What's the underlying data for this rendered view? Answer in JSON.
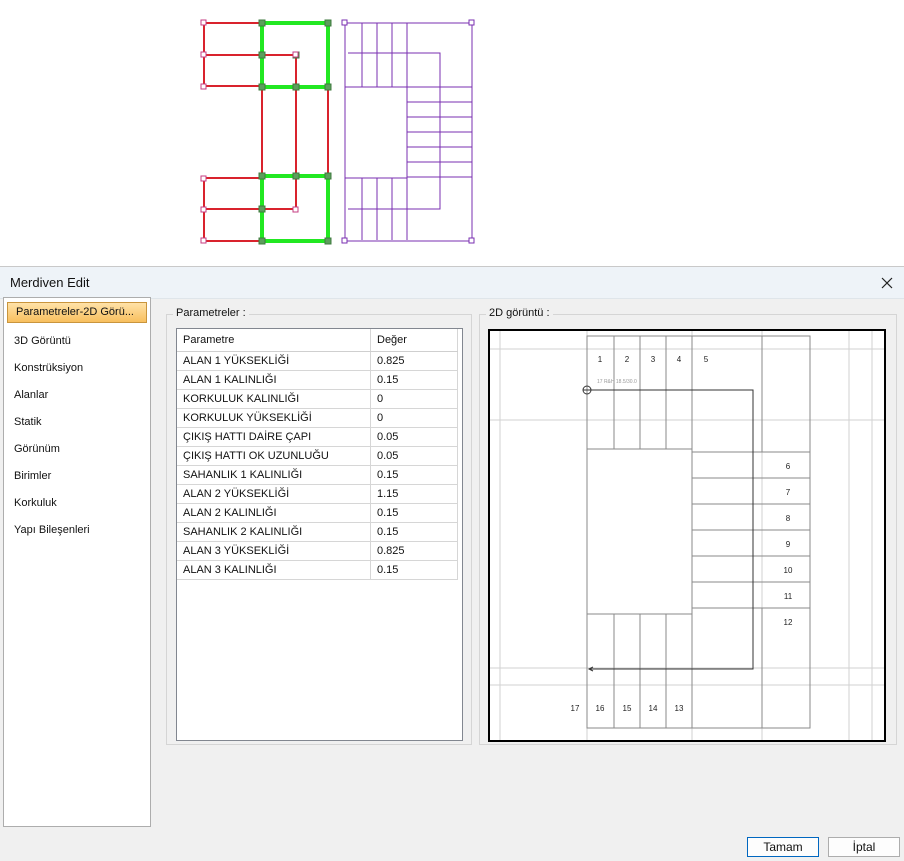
{
  "dialog": {
    "title": "Merdiven Edit",
    "close_icon": "close-icon"
  },
  "nav": {
    "items": [
      "Parametreler-2D Görü...",
      "3D Görüntü",
      "Konstrüksiyon",
      "Alanlar",
      "Statik",
      "Görünüm",
      "Birimler",
      "Korkuluk",
      "Yapı Bileşenleri"
    ],
    "active_index": 0
  },
  "parameters": {
    "legend": "Parametreler :",
    "columns": [
      "Parametre",
      "Değer"
    ],
    "rows": [
      [
        "ALAN 1 YÜKSEKLİĞİ",
        "0.825"
      ],
      [
        "ALAN 1 KALINLIĞI",
        "0.15"
      ],
      [
        "KORKULUK KALINLIĞI",
        "0"
      ],
      [
        "KORKULUK YÜKSEKLİĞİ",
        "0"
      ],
      [
        "ÇIKIŞ HATTI DAİRE ÇAPI",
        "0.05"
      ],
      [
        "ÇIKIŞ HATTI OK UZUNLUĞU",
        "0.05"
      ],
      [
        "SAHANLIK 1 KALINLIĞI",
        "0.15"
      ],
      [
        "ALAN 2 YÜKSEKLİĞİ",
        "1.15"
      ],
      [
        "ALAN 2 KALINLIĞI",
        "0.15"
      ],
      [
        "SAHANLIK 2 KALINLIĞI",
        "0.15"
      ],
      [
        "ALAN 3 YÜKSEKLİĞİ",
        "0.825"
      ],
      [
        "ALAN 3 KALINLIĞI",
        "0.15"
      ]
    ]
  },
  "preview": {
    "legend": "2D görüntü :",
    "top_steps": [
      "1",
      "2",
      "3",
      "4",
      "5"
    ],
    "right_steps": [
      "6",
      "7",
      "8",
      "9",
      "10",
      "11",
      "12"
    ],
    "bottom_steps": [
      "13",
      "14",
      "15",
      "16",
      "17"
    ],
    "annotation": "17 R&H 18.5/30.0"
  },
  "buttons": {
    "ok": "Tamam",
    "cancel": "İptal"
  },
  "colors": {
    "frame_red": "#d9232d",
    "frame_green": "#22e822",
    "stair_purple": "#7a2fb0",
    "nav_active": "#f8bf5e"
  }
}
